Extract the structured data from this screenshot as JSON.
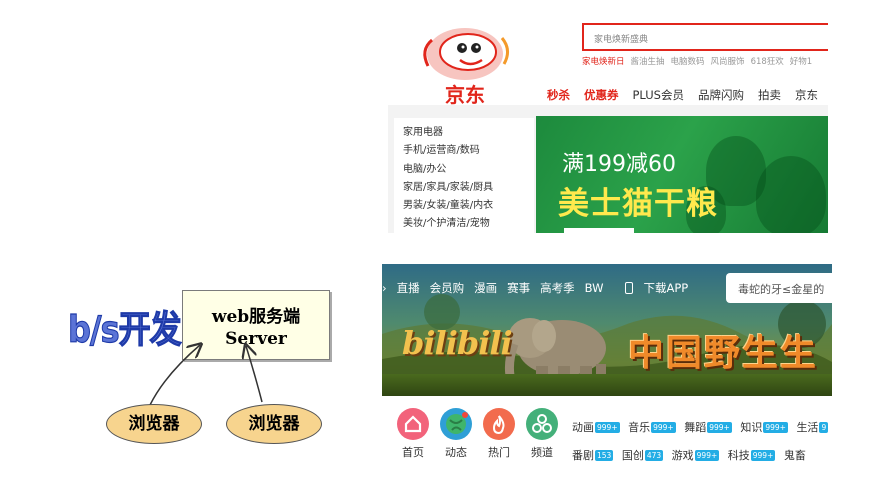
{
  "jd": {
    "logo_text": "京东",
    "search_placeholder": "家电焕新盛典",
    "hot_words": [
      "家电焕新日",
      "酱油生抽",
      "电脑数码",
      "风尚服饰",
      "618狂欢",
      "好物1"
    ],
    "nav": [
      "秒杀",
      "优惠券",
      "PLUS会员",
      "品牌闪购",
      "拍卖",
      "京东"
    ],
    "categories": [
      "家用电器",
      "手机/运营商/数码",
      "电脑/办公",
      "家居/家具/家装/厨具",
      "男装/女装/童装/内衣",
      "美妆/个护清洁/宠物"
    ],
    "banner": {
      "line1": "满199减60",
      "line2": "美士猫干粮"
    }
  },
  "bili": {
    "nav": [
      "直播",
      "会员购",
      "漫画",
      "赛事",
      "高考季",
      "BW"
    ],
    "app_label": "下载APP",
    "search_placeholder": "毒蛇的牙≤金星的",
    "logo": "bilibili",
    "banner_title": "中国野生生",
    "icons": [
      {
        "label": "首页",
        "color": "#f2637b",
        "icon": "home-icon"
      },
      {
        "label": "动态",
        "color": "#2f9fd6",
        "icon": "globe-icon"
      },
      {
        "label": "热门",
        "color": "#f26b4d",
        "icon": "flame-icon"
      },
      {
        "label": "频道",
        "color": "#44b07a",
        "icon": "channel-icon"
      }
    ],
    "categories_row1": [
      {
        "name": "动画",
        "count": "999+"
      },
      {
        "name": "音乐",
        "count": "999+"
      },
      {
        "name": "舞蹈",
        "count": "999+"
      },
      {
        "name": "知识",
        "count": "999+"
      },
      {
        "name": "生活",
        "count": "9"
      }
    ],
    "categories_row2": [
      {
        "name": "番剧",
        "count": "153"
      },
      {
        "name": "国创",
        "count": "473"
      },
      {
        "name": "游戏",
        "count": "999+"
      },
      {
        "name": "科技",
        "count": "999+"
      },
      {
        "name": "鬼畜",
        "count": ""
      }
    ]
  },
  "diagram": {
    "title": "b/s开发",
    "server_line1": "web服务端",
    "server_line2": "Server",
    "browser_left": "浏览器",
    "browser_right": "浏览器"
  },
  "colors": {
    "jd_red": "#e1251b",
    "bili_blue": "#23ade5",
    "bs_blue": "#5b74d6"
  }
}
